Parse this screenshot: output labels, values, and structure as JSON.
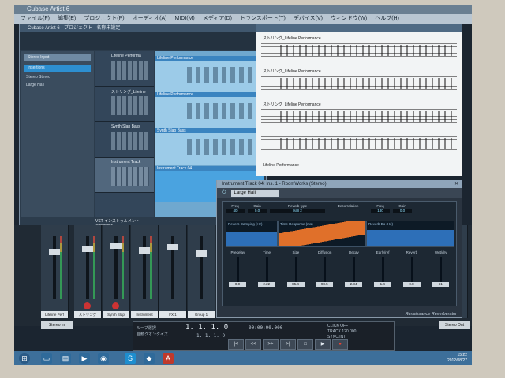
{
  "app": {
    "title": "Cubase Artist 6"
  },
  "menu": [
    "ファイル(F)",
    "編集(E)",
    "プロジェクト(P)",
    "オーディオ(A)",
    "MIDI(M)",
    "メディア(D)",
    "トランスポート(T)",
    "デバイス(V)",
    "ウィンドウ(W)",
    "ヘルプ(H)"
  ],
  "project": {
    "title": "Cubase Artist 6 - プロジェクト - 名称未設定",
    "inspector": [
      "Stereo Input",
      "Insertions",
      "Stereo Stereo",
      "Large Hall"
    ],
    "tracks": [
      {
        "name": "Lifeline Performa"
      },
      {
        "name": "ストリング_Lifeline"
      },
      {
        "name": "Synth Slap Bass"
      },
      {
        "name": "Instrument Track"
      }
    ],
    "vsti": "VST インストゥルメント",
    "vsti_sub": "Absynth 5",
    "parts": [
      "Lifeline Performance",
      "Lifeline Performance",
      "Synth Slap Bass",
      "Instrument Track 04"
    ]
  },
  "score": {
    "labels": [
      "ストリング_Lifeline Performance",
      "ストリング_Lifeline Performance",
      "ストリング_Lifeline Performance",
      "Lifeline Performance"
    ]
  },
  "plugin": {
    "title": "Instrument Track 04: Ins. 1 - RoomWorks (Stereo)",
    "preset": "Large Hall",
    "top_params": [
      {
        "label": "Freq",
        "value": "40"
      },
      {
        "label": "Gain",
        "value": "0.0"
      },
      {
        "label": "Freq",
        "value": "180"
      },
      {
        "label": "Gain",
        "value": "0.0"
      }
    ],
    "reverb_type": "Reverb type",
    "reverb_type_value": "Hall 2",
    "decorrelation": "Decorrelation",
    "graph_labels": [
      "Reverb Damping (Hz)",
      "Time Response (ms)",
      "Reverb Bo (Hz)"
    ],
    "sliders": [
      {
        "label": "Predelay",
        "value": "0.0"
      },
      {
        "label": "Time",
        "value": "2.22"
      },
      {
        "label": "Size",
        "value": "85.4"
      },
      {
        "label": "Diffusion",
        "value": "98.5"
      },
      {
        "label": "Decay",
        "value": "2.84"
      },
      {
        "label": "Early/ref",
        "value": "1.4"
      },
      {
        "label": "Reverb",
        "value": "0.8"
      },
      {
        "label": "Wet/dry",
        "value": "31"
      }
    ],
    "brand": "Renaissance Reverberator"
  },
  "mixer": {
    "stereo_in": "Stereo In",
    "stereo_out": "Stereo Out",
    "channels": [
      "Lifeline Perf",
      "ストリング",
      "Synth Slap",
      "Instrument",
      "FX 1",
      "Group 1",
      "Stereo In"
    ]
  },
  "transport": {
    "position": "1. 1. 1. 0",
    "time": "00:00:00.000",
    "left": [
      "ループ選択",
      "自動クオンタイズ"
    ],
    "mid_a": "1. 1. 1. 0",
    "mid_b": "13. 1. 1. 0",
    "click": "CLICK OFF",
    "tempo": "TRACK 120.000",
    "sync": "SYNC INT",
    "controls": [
      "|<",
      "<<",
      ">>",
      ">|",
      "□",
      "▶",
      "●"
    ]
  },
  "taskbar": {
    "clock": "15:22",
    "date": "2012/08/27"
  }
}
